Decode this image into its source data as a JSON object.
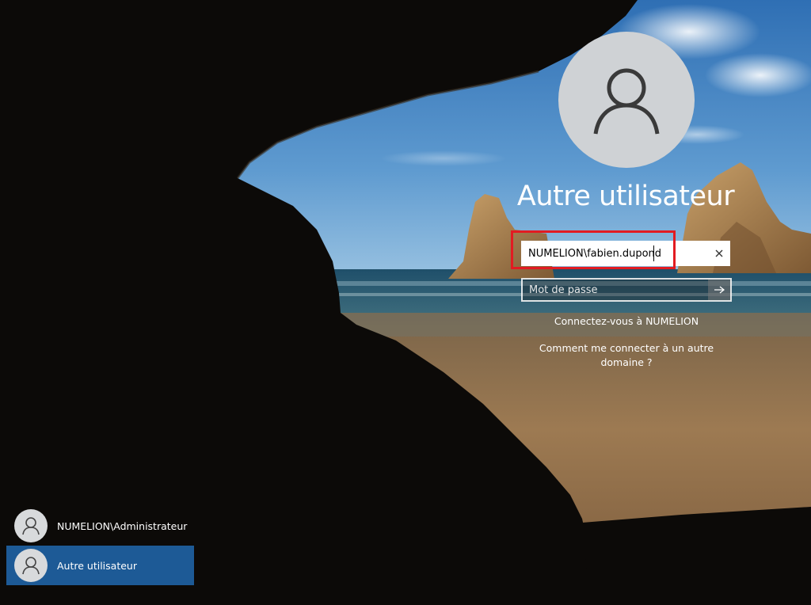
{
  "login": {
    "title": "Autre utilisateur",
    "username_value": "NUMELION\\fabien.dupond",
    "password_placeholder": "Mot de passe",
    "connect_domain_text": "Connectez-vous à NUMELION",
    "other_domain_text": "Comment me connecter à un autre domaine ?"
  },
  "user_list": {
    "items": [
      {
        "label": "NUMELION\\Administrateur",
        "selected": false
      },
      {
        "label": "Autre utilisateur",
        "selected": true
      }
    ]
  },
  "icons": {
    "avatar": "user-icon",
    "clear": "close-icon",
    "submit": "arrow-right-icon"
  },
  "colors": {
    "highlight_border": "#e21b22",
    "selected_user_bg": "#1d5a96",
    "avatar_bg": "#cfd2d5"
  }
}
